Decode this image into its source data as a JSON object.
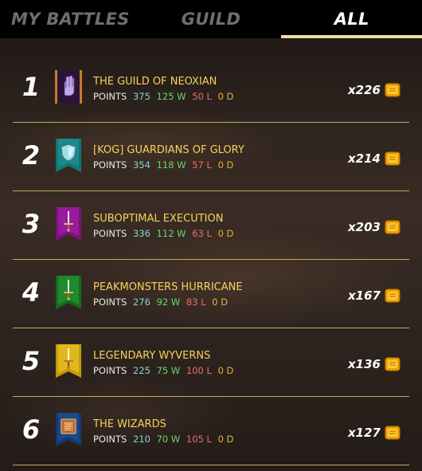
{
  "tabs": [
    {
      "label": "MY BATTLES",
      "active": false
    },
    {
      "label": "GUILD",
      "active": false
    },
    {
      "label": "ALL",
      "active": true
    }
  ],
  "stats_label": "POINTS",
  "rows": [
    {
      "rank": "1",
      "name": "THE GUILD OF NEOXIAN",
      "points": "375",
      "wins": "125 W",
      "losses": "50 L",
      "draws": "0 D",
      "reward": "x226",
      "banner_color": "#2a1438",
      "banner_icon": "hand-icon"
    },
    {
      "rank": "2",
      "name": "[KOG] GUARDIANS OF GLORY",
      "points": "354",
      "wins": "118 W",
      "losses": "57 L",
      "draws": "0 D",
      "reward": "x214",
      "banner_color": "#1a8a8a",
      "banner_icon": "shield-icon"
    },
    {
      "rank": "3",
      "name": "SUBOPTIMAL EXECUTION",
      "points": "336",
      "wins": "112 W",
      "losses": "63 L",
      "draws": "0 D",
      "reward": "x203",
      "banner_color": "#9a1a9a",
      "banner_icon": "sword-icon"
    },
    {
      "rank": "4",
      "name": "PEAKMONSTERS HURRICANE",
      "points": "276",
      "wins": "92 W",
      "losses": "83 L",
      "draws": "0 D",
      "reward": "x167",
      "banner_color": "#1f8a2a",
      "banner_icon": "sword-icon"
    },
    {
      "rank": "5",
      "name": "LEGENDARY WYVERNS",
      "points": "225",
      "wins": "75 W",
      "losses": "100 L",
      "draws": "0 D",
      "reward": "x136",
      "banner_color": "#e0b81a",
      "banner_icon": "sword-icon"
    },
    {
      "rank": "6",
      "name": "THE WIZARDS",
      "points": "210",
      "wins": "70 W",
      "losses": "105 L",
      "draws": "0 D",
      "reward": "x127",
      "banner_color": "#1a4a8a",
      "banner_icon": "book-icon"
    }
  ],
  "colors": {
    "accent": "#f3d9a2",
    "name": "#f6d25a",
    "points": "#7fd6d6",
    "wins": "#67d86b",
    "losses": "#e66f6f",
    "draws": "#e8b33c",
    "divider": "#c9a760"
  }
}
